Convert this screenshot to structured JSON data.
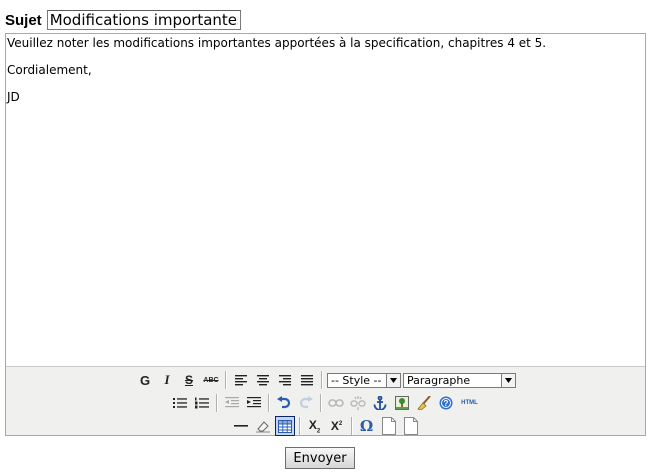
{
  "subject": {
    "label": "Sujet",
    "value": "Modifications importantes"
  },
  "editor": {
    "lines": [
      "Veuillez noter les modifications importantes apportées à la specification, chapitres 4 et 5.",
      "Cordialement,",
      "JD"
    ]
  },
  "toolbar": {
    "bold_label": "G",
    "italic_label": "I",
    "strike_label": "S",
    "spellcheck_label": "ABC",
    "style_select_value": "-- Style --",
    "format_select_value": "Paragraphe",
    "html_label": "HTML",
    "subscript_label": "X",
    "subscript_mark": "2",
    "superscript_label": "X",
    "superscript_mark": "2",
    "omega_label": "Ω",
    "icons": [
      "bold-icon",
      "italic-icon",
      "strikethrough-icon",
      "spellcheck-icon",
      "align-left-icon",
      "align-center-icon",
      "align-right-icon",
      "align-justify-icon",
      "bulleted-list-icon",
      "numbered-list-icon",
      "outdent-icon",
      "indent-icon",
      "undo-icon",
      "redo-icon",
      "link-icon",
      "unlink-icon",
      "anchor-icon",
      "image-icon",
      "cleanup-icon",
      "help-icon",
      "html-icon",
      "horizontal-rule-icon",
      "eraser-icon",
      "table-icon",
      "subscript-icon",
      "superscript-icon",
      "special-char-icon",
      "new-document-icon",
      "paste-text-icon"
    ]
  },
  "submit": {
    "label": "Envoyer"
  }
}
